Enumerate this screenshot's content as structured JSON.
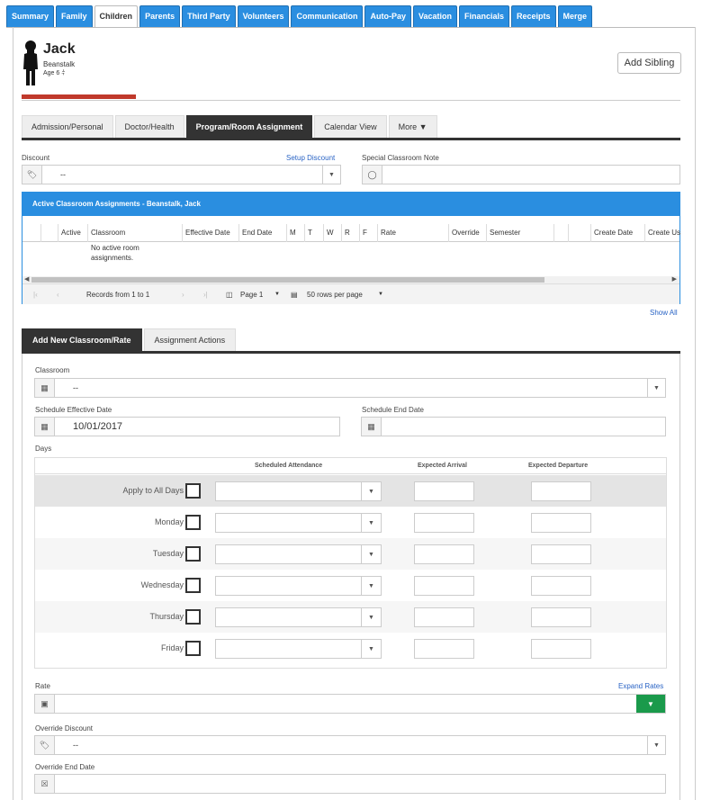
{
  "top_tabs": [
    "Summary",
    "Family",
    "Children",
    "Parents",
    "Third Party",
    "Volunteers",
    "Communication",
    "Auto-Pay",
    "Vacation",
    "Financials",
    "Receipts",
    "Merge"
  ],
  "active_top_tab": "Children",
  "child": {
    "name": "Jack",
    "classroom": "Beanstalk",
    "age": "Age 6"
  },
  "add_sibling_label": "Add Sibling",
  "sub_tabs": [
    "Admission/Personal",
    "Doctor/Health",
    "Program/Room Assignment",
    "Calendar View",
    "More"
  ],
  "active_sub_tab": "Program/Room Assignment",
  "discount": {
    "label": "Discount",
    "link": "Setup Discount",
    "value": "--"
  },
  "special_note": {
    "label": "Special Classroom Note",
    "value": ""
  },
  "active_assignments": {
    "title": "Active Classroom Assignments - Beanstalk, Jack",
    "columns": [
      "Active",
      "Classroom",
      "Effective Date",
      "End Date",
      "M",
      "T",
      "W",
      "R",
      "F",
      "Rate",
      "Override",
      "Semester",
      "Create Date",
      "Create Us"
    ],
    "empty_text": "No active room assignments.",
    "pager": {
      "records": "Records from 1 to 1",
      "page": "Page 1",
      "rows": "50 rows per page"
    },
    "show_all": "Show All"
  },
  "form_tabs": [
    "Add New Classroom/Rate",
    "Assignment Actions"
  ],
  "form": {
    "classroom_label": "Classroom",
    "classroom_value": "--",
    "effective_label": "Schedule Effective Date",
    "effective_value": "10/01/2017",
    "end_label": "Schedule End Date",
    "end_value": "",
    "days_label": "Days",
    "days_headers": [
      "Scheduled Attendance",
      "Expected Arrival",
      "Expected Departure"
    ],
    "days": [
      "Apply to All Days",
      "Monday",
      "Tuesday",
      "Wednesday",
      "Thursday",
      "Friday"
    ],
    "rate_label": "Rate",
    "expand_rates": "Expand Rates",
    "override_discount_label": "Override Discount",
    "override_discount_value": "--",
    "override_end_label": "Override End Date"
  }
}
